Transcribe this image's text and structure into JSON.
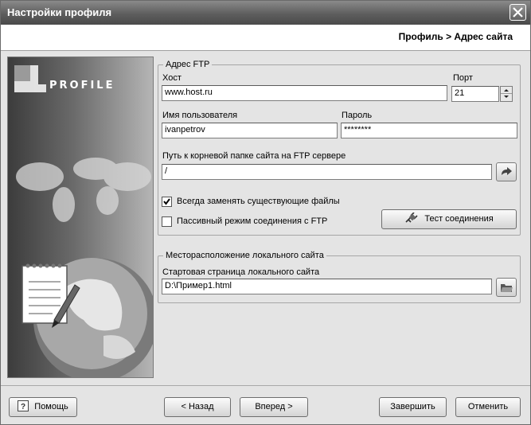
{
  "window": {
    "title": "Настройки профиля"
  },
  "header": {
    "breadcrumb": "Профиль > Адрес сайта"
  },
  "side": {
    "logo_text": "PROFILE"
  },
  "ftp": {
    "legend": "Адрес FTP",
    "host_label": "Хост",
    "host_value": "www.host.ru",
    "port_label": "Порт",
    "port_value": "21",
    "user_label": "Имя пользователя",
    "user_value": "ivanpetrov",
    "password_label": "Пароль",
    "password_value": "********",
    "root_label": "Путь к корневой папке сайта на FTP сервере",
    "root_value": "/",
    "overwrite_label": "Всегда заменять существующие файлы",
    "overwrite_checked": true,
    "passive_label": "Пассивный режим соединения с FTP",
    "passive_checked": false,
    "test_button": "Тест соединения"
  },
  "local": {
    "legend": "Месторасположение локального сайта",
    "start_page_label": "Стартовая страница локального сайта",
    "start_page_value": "D:\\Пример1.html"
  },
  "footer": {
    "help": "Помощь",
    "back": "< Назад",
    "next": "Вперед >",
    "finish": "Завершить",
    "cancel": "Отменить"
  }
}
